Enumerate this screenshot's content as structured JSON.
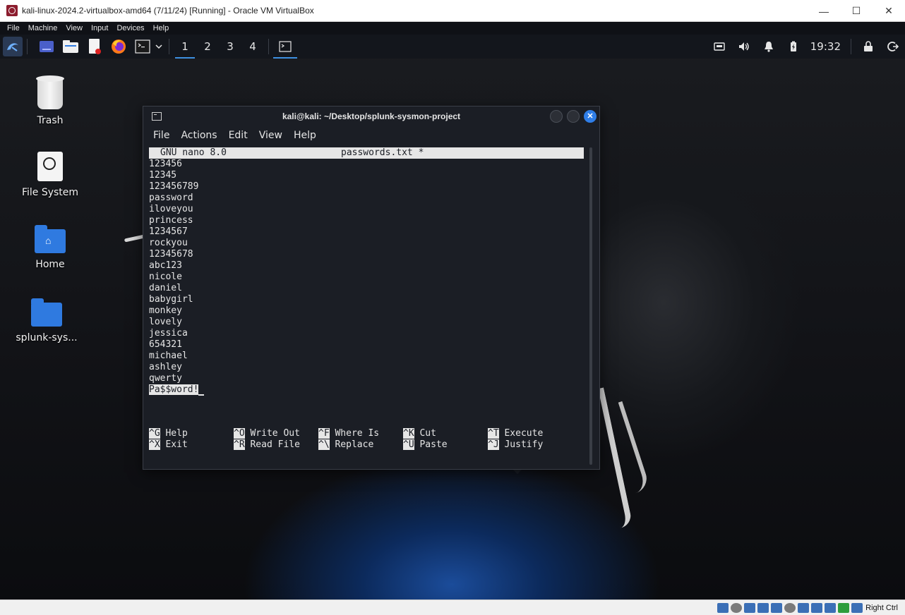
{
  "host": {
    "title": "kali-linux-2024.2-virtualbox-amd64 (7/11/24) [Running] - Oracle VM VirtualBox",
    "controls": {
      "minimize": "—",
      "maximize": "☐",
      "close": "✕"
    },
    "menu": [
      "File",
      "Machine",
      "View",
      "Input",
      "Devices",
      "Help"
    ],
    "status": {
      "host_key_label": "Right Ctrl"
    }
  },
  "panel": {
    "workspaces": [
      "1",
      "2",
      "3",
      "4"
    ],
    "active_workspace": "1",
    "clock": "19:32"
  },
  "desktop": {
    "icons": [
      {
        "label": "Trash",
        "icon": "trash-icon"
      },
      {
        "label": "File System",
        "icon": "drive-icon"
      },
      {
        "label": "Home",
        "icon": "home-folder-icon"
      },
      {
        "label": "splunk-sys...",
        "icon": "folder-icon"
      }
    ]
  },
  "terminal": {
    "title": "kali@kali: ~/Desktop/splunk-sysmon-project",
    "menu": [
      "File",
      "Actions",
      "Edit",
      "View",
      "Help"
    ],
    "nano": {
      "version": "GNU nano 8.0",
      "filename": "passwords.txt *",
      "lines": [
        "123456",
        "12345",
        "123456789",
        "password",
        "iloveyou",
        "princess",
        "1234567",
        "rockyou",
        "12345678",
        "abc123",
        "nicole",
        "daniel",
        "babygirl",
        "monkey",
        "lovely",
        "jessica",
        "654321",
        "michael",
        "ashley",
        "qwerty"
      ],
      "current_line": "Pa$$word!",
      "shortcuts_row1": [
        {
          "key": "^G",
          "label": "Help"
        },
        {
          "key": "^O",
          "label": "Write Out"
        },
        {
          "key": "^F",
          "label": "Where Is"
        },
        {
          "key": "^K",
          "label": "Cut"
        },
        {
          "key": "^T",
          "label": "Execute"
        }
      ],
      "shortcuts_row2": [
        {
          "key": "^X",
          "label": "Exit"
        },
        {
          "key": "^R",
          "label": "Read File"
        },
        {
          "key": "^\\",
          "label": "Replace"
        },
        {
          "key": "^U",
          "label": "Paste"
        },
        {
          "key": "^J",
          "label": "Justify"
        }
      ]
    }
  },
  "colors": {
    "accent": "#3d8fe0",
    "panel_bg": "#13161c",
    "terminal_bg": "#1b1e25",
    "folder": "#2f7ae0"
  }
}
